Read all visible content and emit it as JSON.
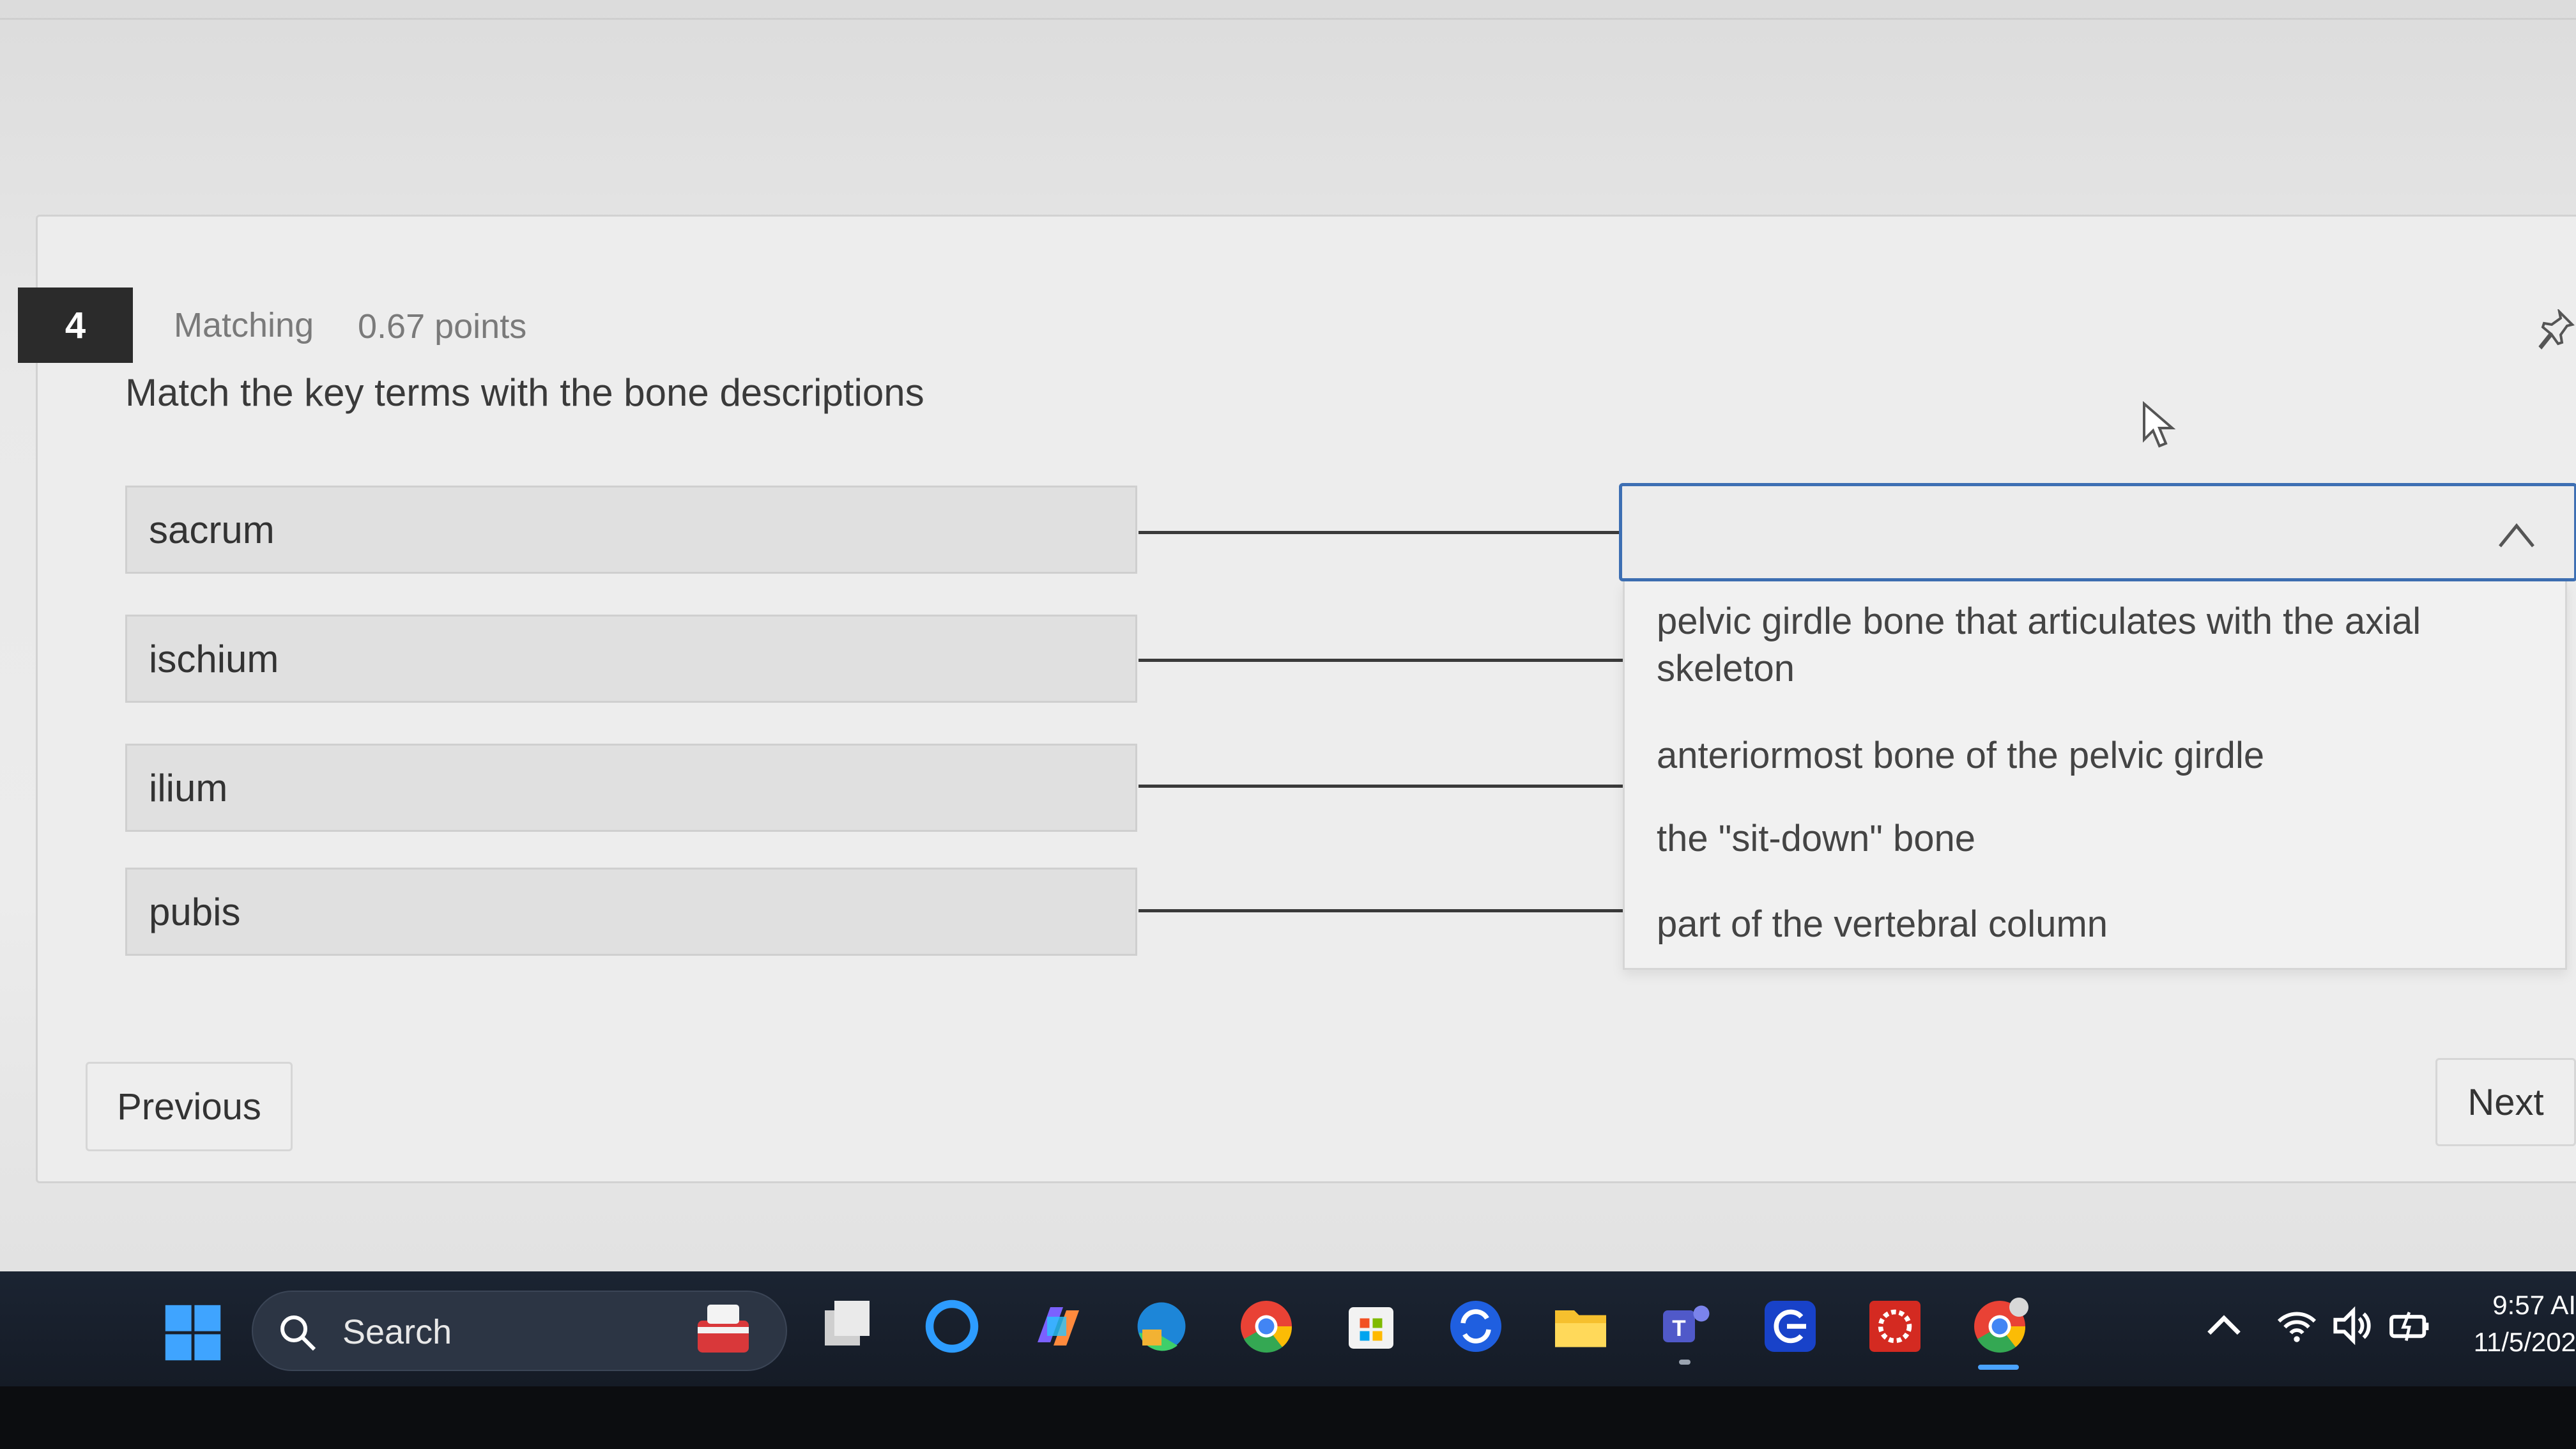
{
  "question": {
    "number": "4",
    "type": "Matching",
    "points": "0.67 points",
    "prompt": "Match the key terms with the bone descriptions"
  },
  "terms": [
    "sacrum",
    "ischium",
    "ilium",
    "pubis"
  ],
  "dropdown": {
    "selected_value": "",
    "options": [
      "pelvic girdle bone that articulates with the axial skeleton",
      "anteriormost bone of the pelvic girdle",
      "the \"sit-down\" bone",
      "part of the vertebral column"
    ]
  },
  "nav": {
    "previous_label": "Previous",
    "next_label": "Next"
  },
  "taskbar": {
    "search_label": "Search",
    "apps": [
      "start-icon",
      "task-view-icon",
      "cortana-icon",
      "copilot-icon",
      "edge-icon",
      "chrome-icon",
      "store-icon",
      "sync-icon",
      "file-explorer-icon",
      "teams-icon",
      "search-app-icon",
      "red-app-icon",
      "chrome-active-icon"
    ],
    "time": "9:57 AI",
    "date": "11/5/202"
  },
  "colors": {
    "accent_border": "#3d6fb3",
    "taskbar": "#1b2432",
    "question_badge": "#2b2b2b"
  }
}
